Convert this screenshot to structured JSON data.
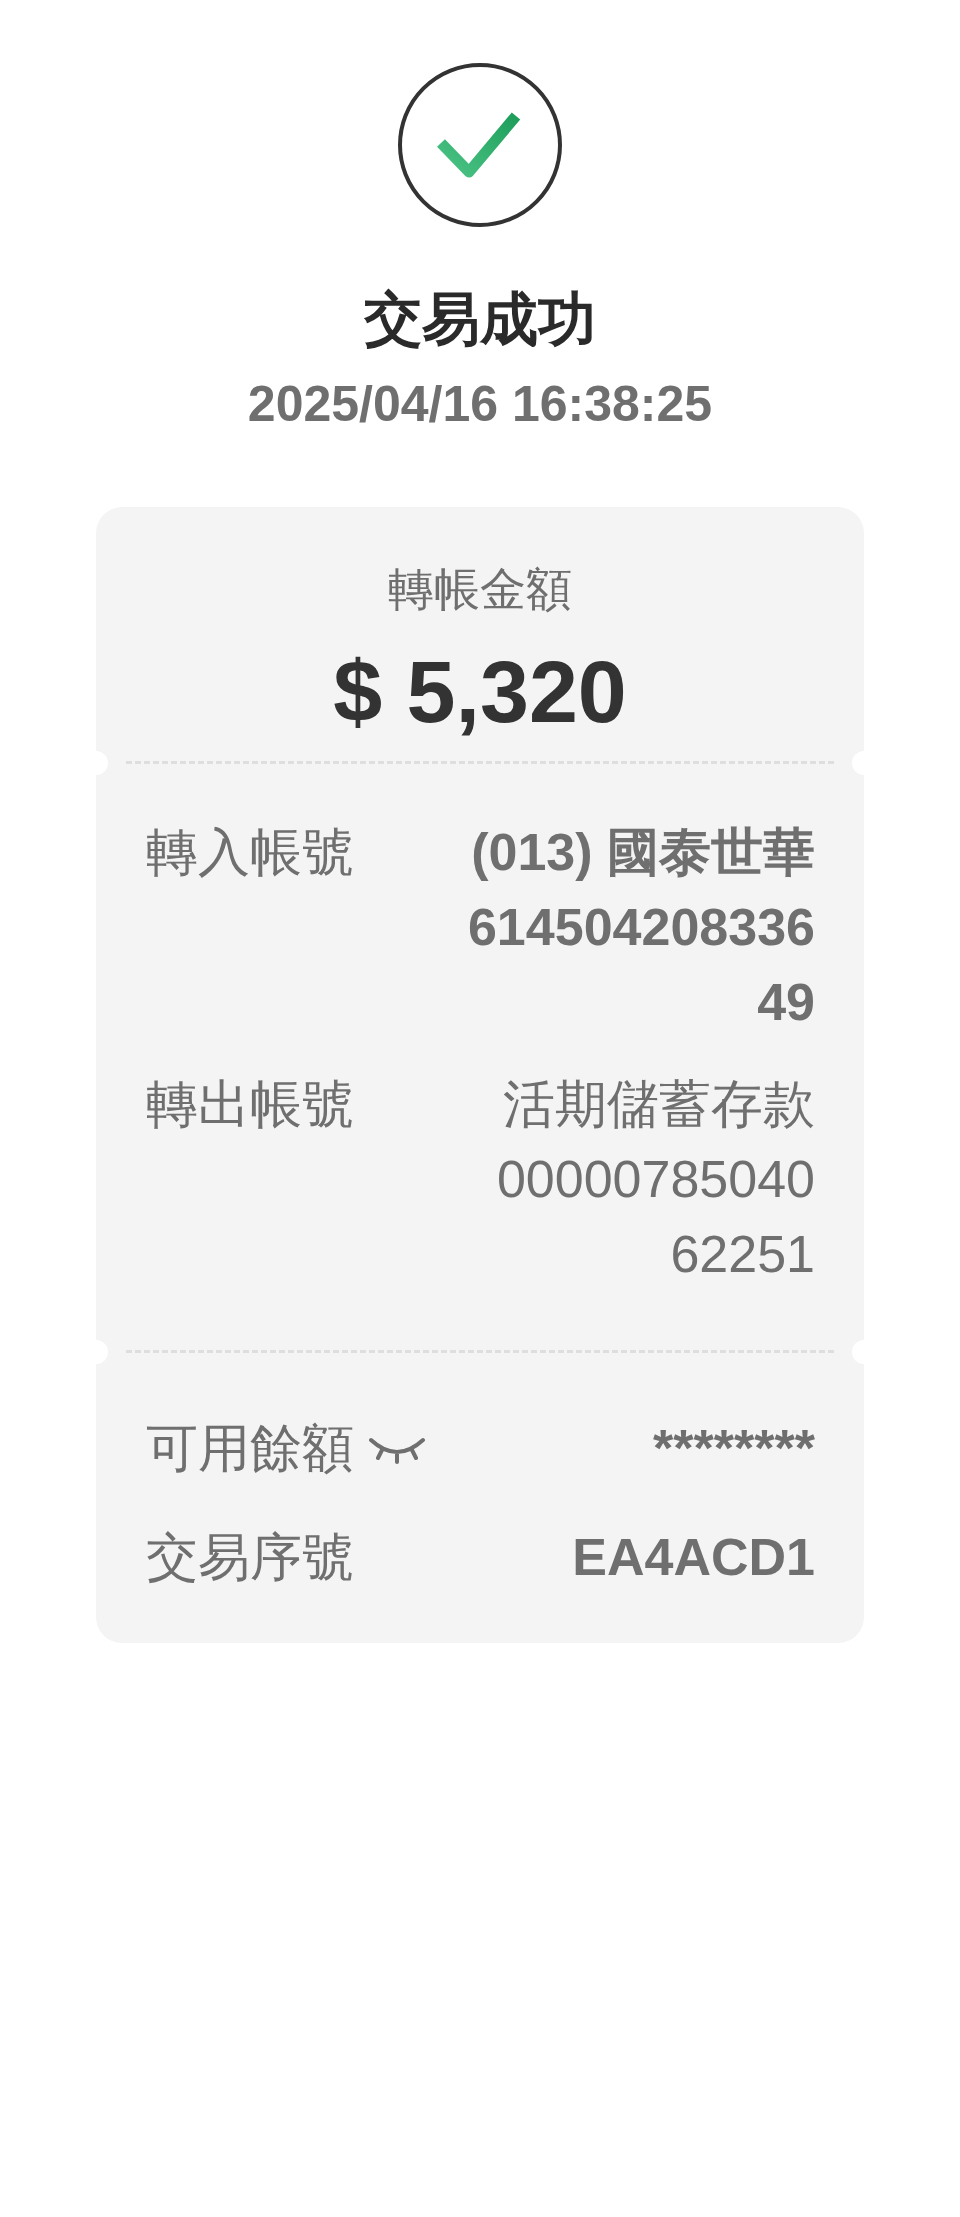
{
  "status": {
    "kind": "success",
    "title": "交易成功",
    "datetime": "2025/04/16 16:38:25"
  },
  "amount": {
    "label": "轉帳金額",
    "value": "$ 5,320"
  },
  "accounts": [
    {
      "label": "轉入帳號",
      "lines": [
        "(013) 國泰世華",
        "614504208336",
        "49"
      ],
      "bold": true
    },
    {
      "label": "轉出帳號",
      "lines": [
        "活期儲蓄存款",
        "00000785040",
        "62251"
      ],
      "bold": false
    }
  ],
  "details": [
    {
      "kind": "balance",
      "label": "可用餘額",
      "value": "********",
      "hidden": true
    },
    {
      "kind": "plain",
      "label": "交易序號",
      "value": "EA4ACD1"
    }
  ]
}
